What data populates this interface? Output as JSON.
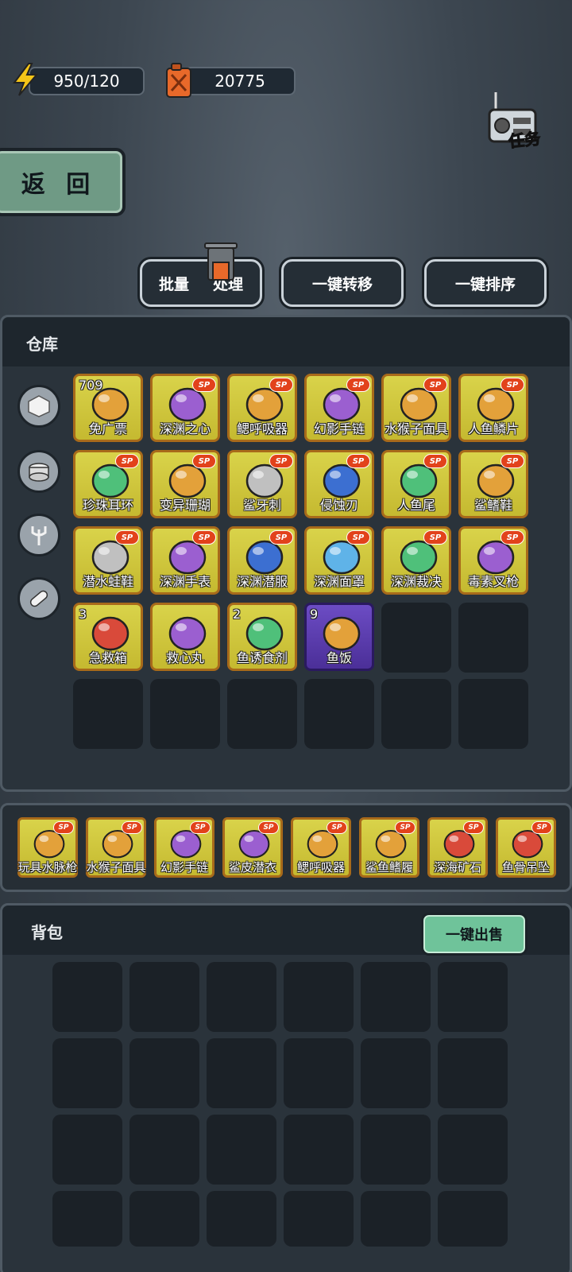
{
  "resources": {
    "energy": "950/120",
    "fuel": "20775"
  },
  "task_label": "任务",
  "back_label": "返 回",
  "actions": {
    "batch_a": "批量",
    "batch_b": "处理",
    "transfer": "一键转移",
    "sort": "一键排序"
  },
  "warehouse": {
    "title": "仓库",
    "items": [
      {
        "name": "免广票",
        "count": "709",
        "sp": false,
        "icon": "ticket-icon"
      },
      {
        "name": "深渊之心",
        "sp": true,
        "icon": "gem-necklace-icon"
      },
      {
        "name": "鳃呼吸器",
        "sp": true,
        "icon": "rebreather-icon"
      },
      {
        "name": "幻影手链",
        "sp": true,
        "icon": "bracelet-icon"
      },
      {
        "name": "水猴子面具",
        "sp": true,
        "icon": "monkey-mask-icon"
      },
      {
        "name": "人鱼鳞片",
        "sp": true,
        "icon": "scale-icon"
      },
      {
        "name": "珍珠耳环",
        "sp": true,
        "icon": "pearl-earring-icon"
      },
      {
        "name": "变异珊瑚",
        "sp": true,
        "icon": "coral-icon"
      },
      {
        "name": "鲨牙刺",
        "sp": true,
        "icon": "shark-teeth-icon"
      },
      {
        "name": "侵蚀刃",
        "sp": true,
        "icon": "blade-icon"
      },
      {
        "name": "人鱼尾",
        "sp": true,
        "icon": "mermaid-tail-icon"
      },
      {
        "name": "鲨鳍鞋",
        "sp": true,
        "icon": "fin-shoes-icon"
      },
      {
        "name": "潜水蛙鞋",
        "sp": true,
        "icon": "flippers-icon"
      },
      {
        "name": "深渊手表",
        "sp": true,
        "icon": "watch-icon"
      },
      {
        "name": "深渊潜服",
        "sp": true,
        "icon": "dive-suit-icon"
      },
      {
        "name": "深渊面罩",
        "sp": true,
        "icon": "dive-mask-icon"
      },
      {
        "name": "深渊裁决",
        "sp": true,
        "icon": "scythe-icon"
      },
      {
        "name": "毒素叉枪",
        "sp": true,
        "icon": "trident-icon"
      },
      {
        "name": "急救箱",
        "count": "3",
        "sp": false,
        "icon": "first-aid-icon"
      },
      {
        "name": "救心丸",
        "sp": false,
        "icon": "medicine-bottle-icon"
      },
      {
        "name": "鱼诱食剂",
        "count": "2",
        "sp": false,
        "icon": "bait-bottle-icon"
      },
      {
        "name": "鱼饭",
        "count": "9",
        "sp": false,
        "icon": "fish-food-icon",
        "rarity": "purple"
      }
    ]
  },
  "equipped": [
    {
      "name": "玩具水脉枪",
      "icon": "water-gun-icon"
    },
    {
      "name": "水猴子面具",
      "icon": "monkey-mask-icon"
    },
    {
      "name": "幻影手链",
      "icon": "bracelet-icon"
    },
    {
      "name": "鲨皮潜衣",
      "icon": "shark-suit-icon"
    },
    {
      "name": "鳃呼吸器",
      "icon": "rebreather-icon"
    },
    {
      "name": "鲨鱼鳍履",
      "icon": "fin-shoes-icon"
    },
    {
      "name": "深海矿石",
      "icon": "crystal-icon"
    },
    {
      "name": "鱼骨吊坠",
      "icon": "fishbone-pendant-icon"
    }
  ],
  "backpack": {
    "title": "背包",
    "sell_label": "一键出售"
  },
  "colors": {
    "item_gold": "#d9d34a",
    "item_purple": "#5a3bb0",
    "sp_badge": "#e2421b",
    "sell_green": "#6fc39a",
    "back_green": "#6f9a85"
  }
}
